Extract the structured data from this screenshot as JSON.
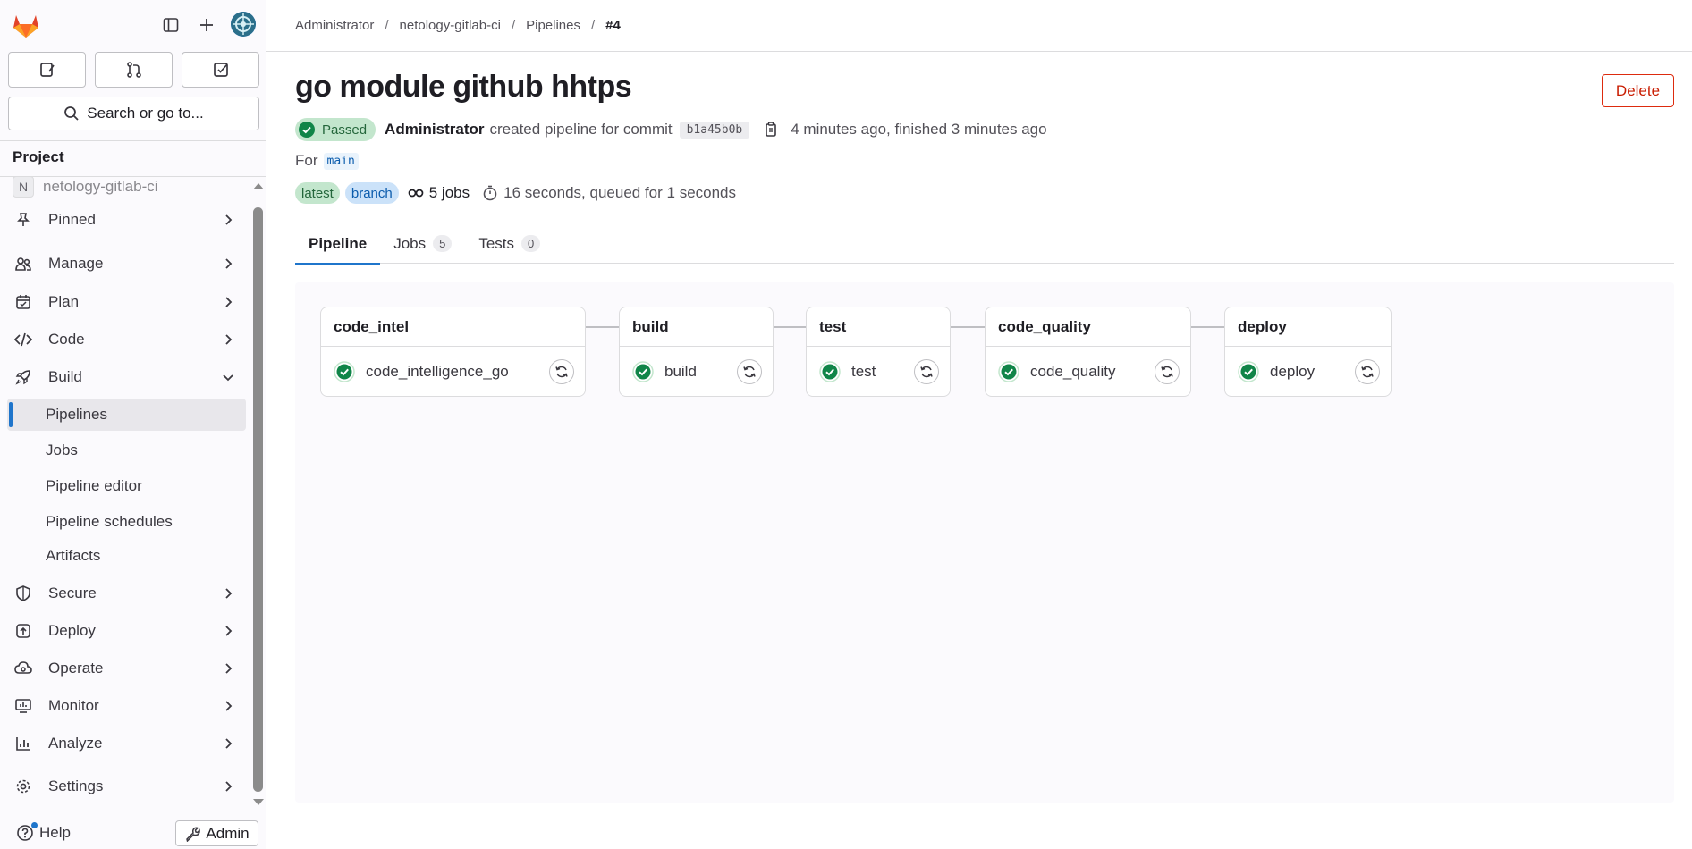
{
  "sidebar": {
    "search_label": "Search or go to...",
    "section_title": "Project",
    "project_initial": "N",
    "project_name": "netology-gitlab-ci",
    "items": [
      {
        "label": "Pinned",
        "icon": "pin-icon"
      },
      {
        "label": "Manage",
        "icon": "users-icon"
      },
      {
        "label": "Plan",
        "icon": "calendar-icon"
      },
      {
        "label": "Code",
        "icon": "code-icon"
      },
      {
        "label": "Build",
        "icon": "rocket-icon"
      },
      {
        "label": "Secure",
        "icon": "shield-icon"
      },
      {
        "label": "Deploy",
        "icon": "deploy-icon"
      },
      {
        "label": "Operate",
        "icon": "cloud-gear-icon"
      },
      {
        "label": "Monitor",
        "icon": "monitor-icon"
      },
      {
        "label": "Analyze",
        "icon": "chart-icon"
      },
      {
        "label": "Settings",
        "icon": "gear-icon"
      }
    ],
    "build_subitems": [
      "Pipelines",
      "Jobs",
      "Pipeline editor",
      "Pipeline schedules",
      "Artifacts"
    ],
    "help_label": "Help",
    "admin_label": "Admin"
  },
  "breadcrumb": [
    "Administrator",
    "netology-gitlab-ci",
    "Pipelines",
    "#4"
  ],
  "pipeline": {
    "title": "go module github hhtps",
    "delete_label": "Delete",
    "status": "Passed",
    "author": "Administrator",
    "created_text": "created pipeline for commit",
    "sha": "b1a45b0b",
    "time_text": "4 minutes ago, finished 3 minutes ago",
    "for_label": "For",
    "ref": "main",
    "tags": [
      "latest",
      "branch"
    ],
    "jobs_text": "5 jobs",
    "duration_text": "16 seconds, queued for 1 seconds"
  },
  "tabs": [
    {
      "label": "Pipeline",
      "count": null
    },
    {
      "label": "Jobs",
      "count": "5"
    },
    {
      "label": "Tests",
      "count": "0"
    }
  ],
  "stages": [
    {
      "name": "code_intel",
      "job": "code_intelligence_go",
      "status": "success"
    },
    {
      "name": "build",
      "job": "build",
      "status": "success"
    },
    {
      "name": "test",
      "job": "test",
      "status": "success"
    },
    {
      "name": "code_quality",
      "job": "code_quality",
      "status": "success"
    },
    {
      "name": "deploy",
      "job": "deploy",
      "status": "success"
    }
  ],
  "colors": {
    "accent": "#1f75cb",
    "success": "#108548",
    "danger": "#dd2b0e"
  }
}
